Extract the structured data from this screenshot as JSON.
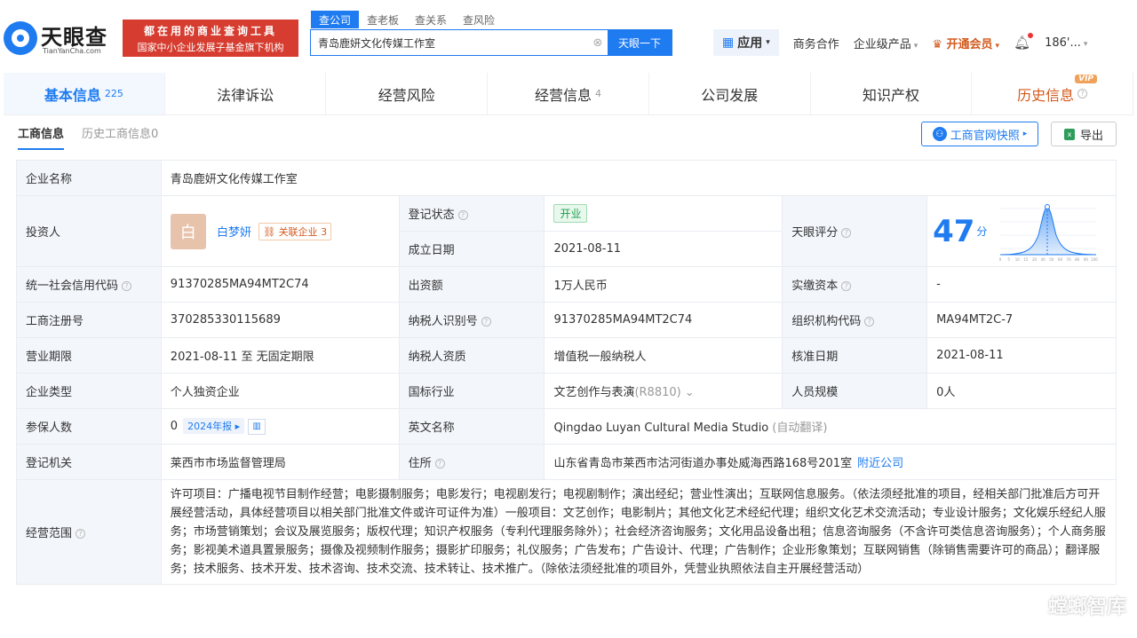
{
  "brand": {
    "name": "天眼查",
    "domain": "TianYanCha.com",
    "slogan_line1": "都在用的商业查询工具",
    "slogan_line2": "国家中小企业发展子基金旗下机构"
  },
  "search": {
    "tabs": [
      "查公司",
      "查老板",
      "查关系",
      "查风险"
    ],
    "active_tab": "查公司",
    "value": "青岛鹿妍文化传媒工作室",
    "button": "天眼一下"
  },
  "nav": {
    "apps": "应用",
    "business": "商务合作",
    "enterprise": "企业级产品",
    "vip": "开通会员",
    "user": "186'..."
  },
  "main_tabs": [
    {
      "label": "基本信息",
      "count": "225"
    },
    {
      "label": "法律诉讼",
      "count": ""
    },
    {
      "label": "经营风险",
      "count": ""
    },
    {
      "label": "经营信息",
      "count": "4"
    },
    {
      "label": "公司发展",
      "count": ""
    },
    {
      "label": "知识产权",
      "count": ""
    },
    {
      "label": "历史信息",
      "count": "",
      "badge": "VIP"
    }
  ],
  "sub_tabs": {
    "active": "工商信息",
    "history": "历史工商信息0"
  },
  "actions": {
    "snapshot": "工商官网快照",
    "export": "导出"
  },
  "company": {
    "name_label": "企业名称",
    "name": "青岛鹿妍文化传媒工作室",
    "investor_label": "投资人",
    "investor_avatar": "白",
    "investor_name": "白梦妍",
    "related_label": "关联企业",
    "related_count": "3",
    "status_label": "登记状态",
    "status": "开业",
    "founded_label": "成立日期",
    "founded": "2021-08-11",
    "score_label": "天眼评分",
    "score": "47",
    "score_unit": "分",
    "credit_code_label": "统一社会信用代码",
    "credit_code": "91370285MA94MT2C74",
    "capital_label": "出资额",
    "capital": "1万人民币",
    "paid_label": "实缴资本",
    "paid": "-",
    "reg_no_label": "工商注册号",
    "reg_no": "370285330115689",
    "tax_id_label": "纳税人识别号",
    "tax_id": "91370285MA94MT2C74",
    "org_code_label": "组织机构代码",
    "org_code": "MA94MT2C-7",
    "term_label": "营业期限",
    "term": "2021-08-11 至 无固定期限",
    "tax_quali_label": "纳税人资质",
    "tax_quali": "增值税一般纳税人",
    "approve_label": "核准日期",
    "approve": "2021-08-11",
    "type_label": "企业类型",
    "type": "个人独资企业",
    "industry_label": "国标行业",
    "industry": "文艺创作与表演",
    "industry_code": "(R8810)",
    "staff_label": "人员规模",
    "staff": "0人",
    "insured_label": "参保人数",
    "insured": "0",
    "insured_year": "2024年报",
    "english_label": "英文名称",
    "english": "Qingdao Luyan Cultural Media Studio",
    "english_note": "(自动翻译)",
    "authority_label": "登记机关",
    "authority": "莱西市市场监督管理局",
    "address_label": "住所",
    "address": "山东省青岛市莱西市沽河街道办事处威海西路168号201室",
    "nearby": "附近公司",
    "scope_label": "经营范围",
    "scope": "许可项目：广播电视节目制作经营；电影摄制服务；电影发行；电视剧发行；电视剧制作；演出经纪；营业性演出；互联网信息服务。（依法须经批准的项目，经相关部门批准后方可开展经营活动，具体经营项目以相关部门批准文件或许可证件为准）一般项目：文艺创作；电影制片；其他文化艺术经纪代理；组织文化艺术交流活动；专业设计服务；文化娱乐经纪人服务；市场营销策划；会议及展览服务；版权代理；知识产权服务（专利代理服务除外）；社会经济咨询服务；文化用品设备出租；信息咨询服务（不含许可类信息咨询服务）；个人商务服务；影视美术道具置景服务；摄像及视频制作服务；摄影扩印服务；礼仪服务；广告发布；广告设计、代理；广告制作；企业形象策划；互联网销售（除销售需要许可的商品）；翻译服务；技术服务、技术开发、技术咨询、技术交流、技术转让、技术推广。（除依法须经批准的项目外，凭营业执照依法自主开展经营活动）"
  },
  "score_chart_ticks": [
    "0",
    "5",
    "10",
    "15",
    "20",
    "40",
    "50",
    "60",
    "70",
    "80",
    "90",
    "100"
  ],
  "watermark": "螳螂智库",
  "colors": {
    "accent": "#1e7bf0",
    "brand_red": "#d63c2f",
    "vip": "#d45a1e",
    "status_green": "#1f9d4f"
  }
}
